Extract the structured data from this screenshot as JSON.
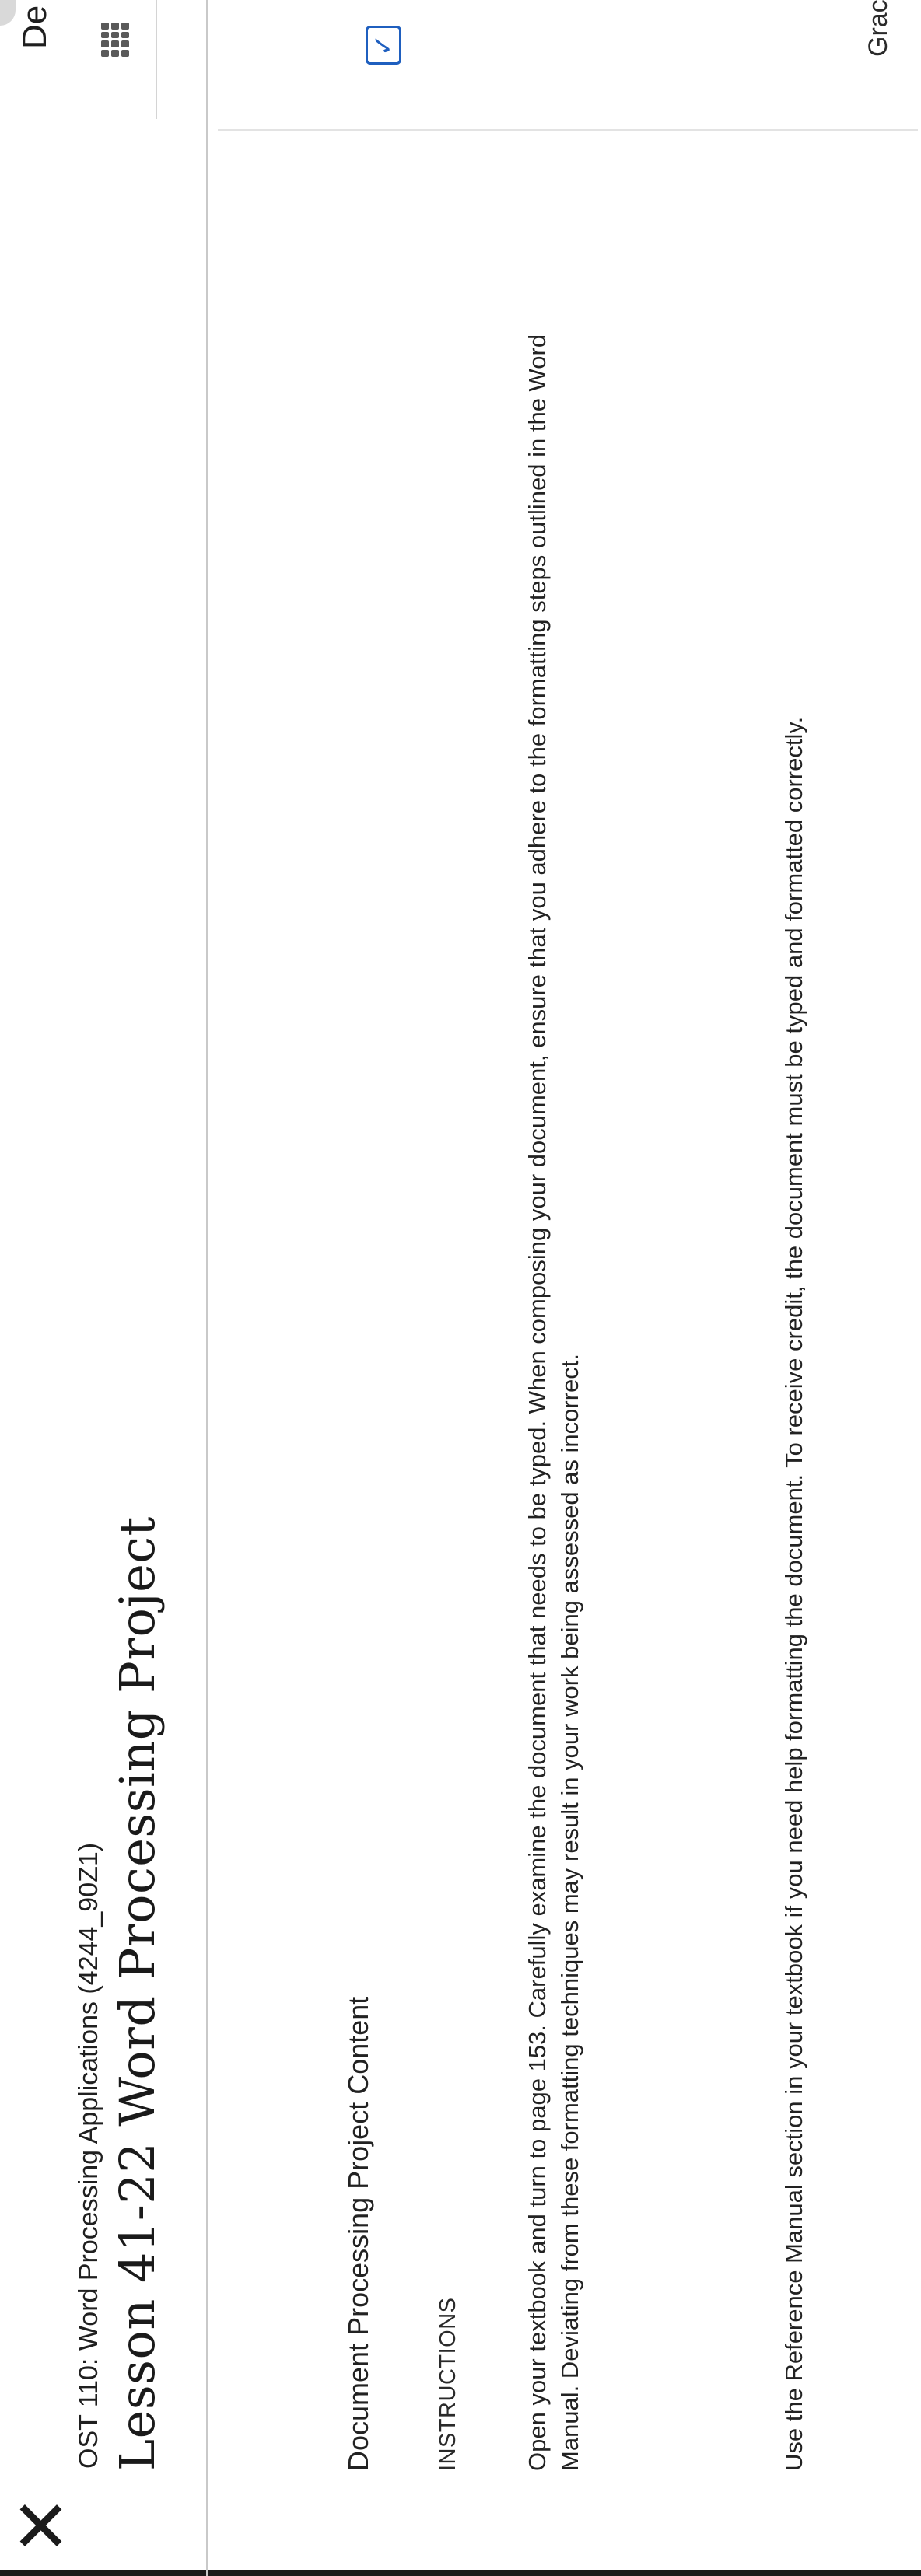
{
  "header": {
    "close_icon": "close-icon",
    "course_title": "OST 110: Word Processing Applications (4244_90Z1)",
    "lesson_title": "Lesson 41-22 Word Processing Project"
  },
  "content": {
    "section_title": "Document Processing Project Content",
    "instructions_label": "INSTRUCTIONS",
    "paragraph_1": "Open your textbook and turn to page 153. Carefully examine the document that needs to be typed. When composing your document, ensure that you adhere to the formatting steps outlined in the Word Manual. Deviating from these formatting techniques may result in your work being assessed as incorrect.",
    "paragraph_2": "Use the Reference Manual section in your textbook if you need help formatting the document. To receive credit, the document must be typed and formatted correctly."
  },
  "side_panel": {
    "tab_label": "De",
    "grid_icon": "grid-icon",
    "check_icon": "check-icon",
    "footer_label": "Grac"
  }
}
